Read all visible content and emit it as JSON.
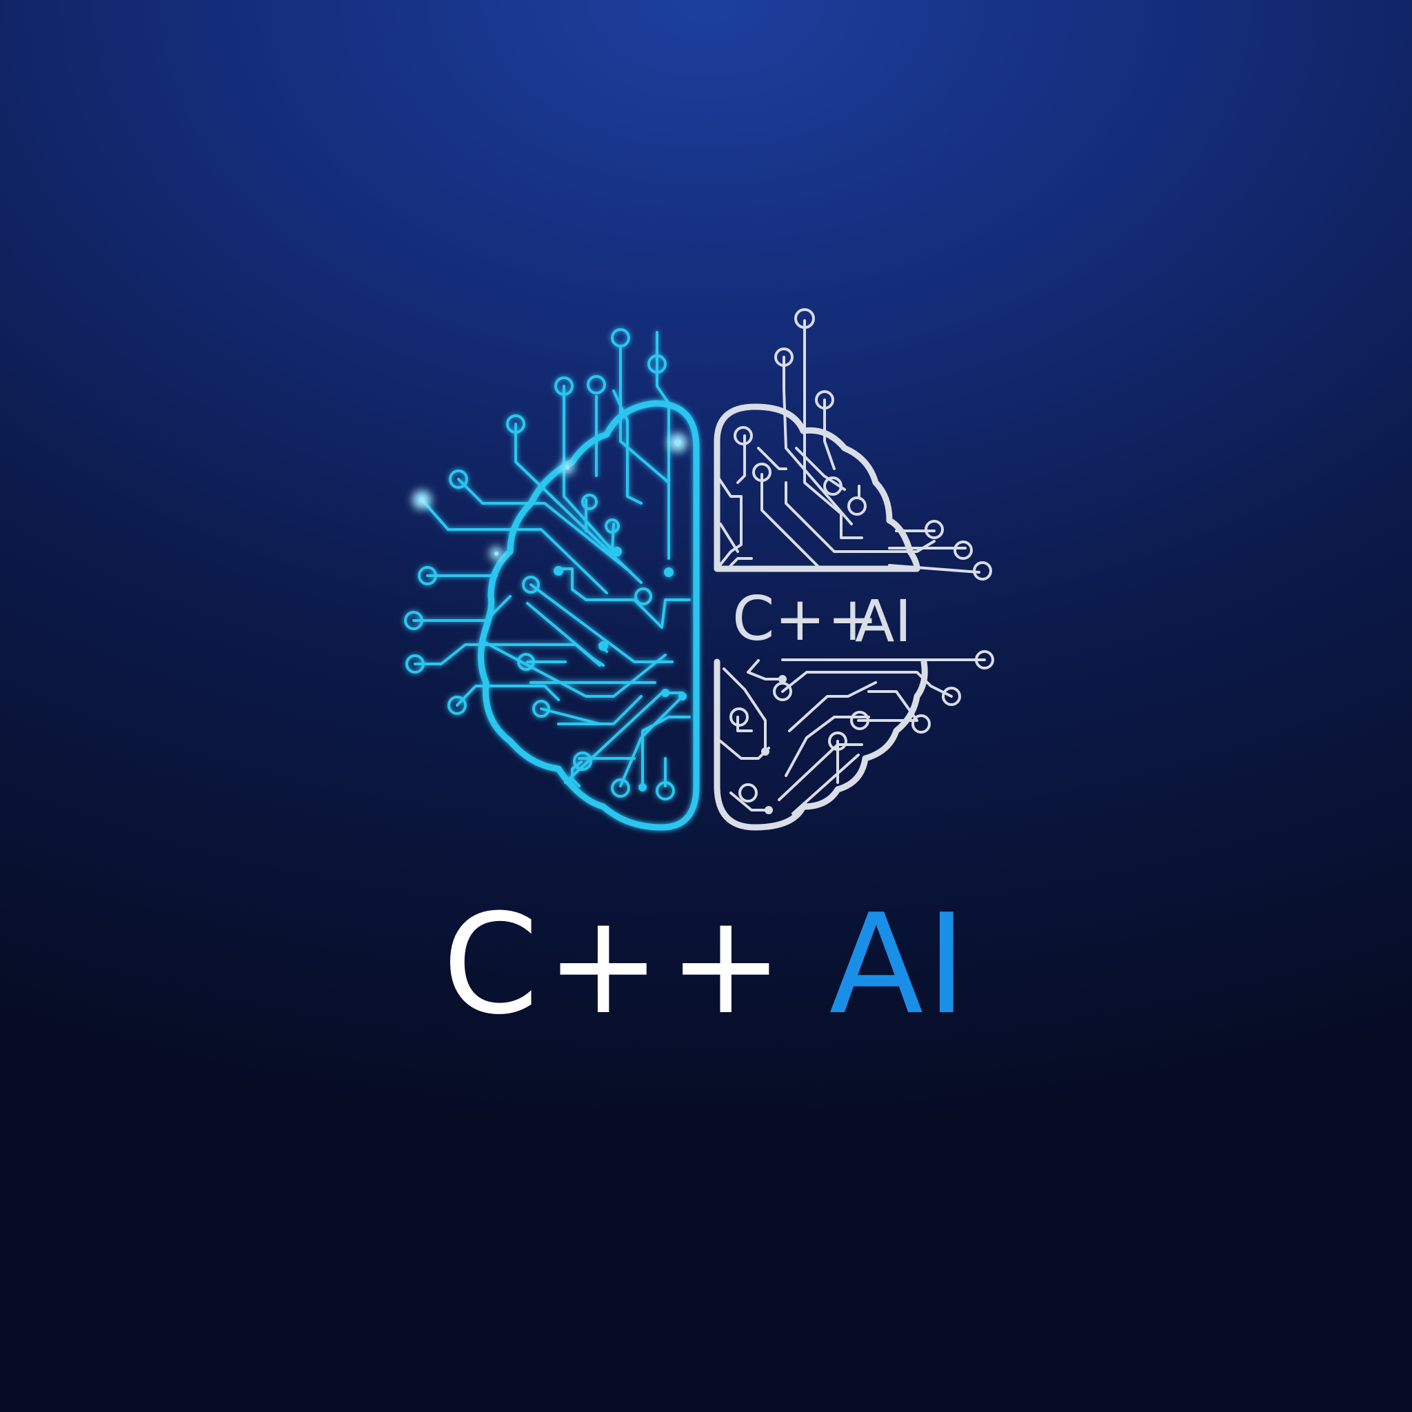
{
  "logo": {
    "icon": "circuit-brain-icon",
    "inner_cpp": "C+",
    "inner_plus": "+",
    "inner_ai": "AI"
  },
  "wordmark": {
    "cpp": "C++",
    "ai": "AI"
  },
  "colors": {
    "background_top": "#1d3f9e",
    "background_bottom": "#060c24",
    "left_hemisphere": "#2bc6f0",
    "right_hemisphere": "#d9dde6",
    "cpp_text": "#ffffff",
    "ai_text": "#1a8fe8"
  }
}
